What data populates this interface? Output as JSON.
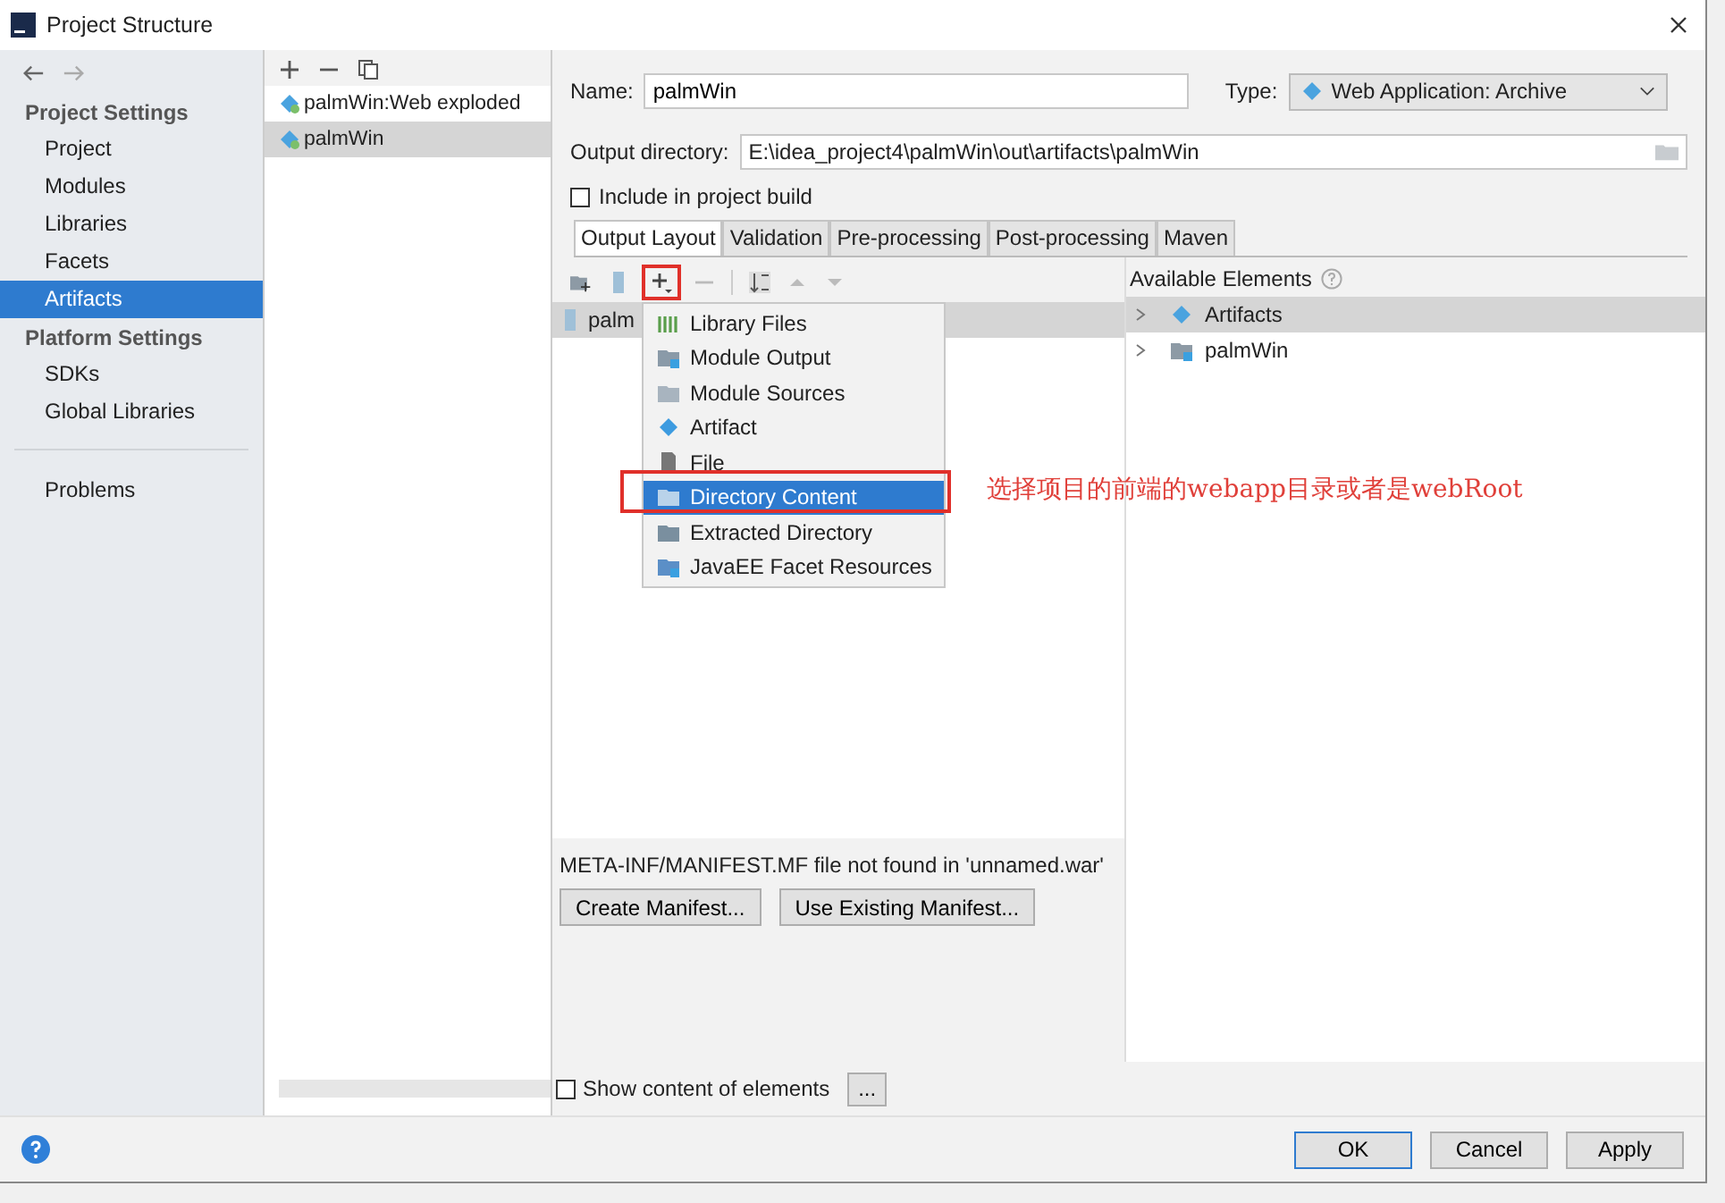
{
  "window": {
    "title": "Project Structure"
  },
  "sidebar": {
    "groups": [
      {
        "title": "Project Settings",
        "items": [
          {
            "label": "Project",
            "selected": false
          },
          {
            "label": "Modules",
            "selected": false
          },
          {
            "label": "Libraries",
            "selected": false
          },
          {
            "label": "Facets",
            "selected": false
          },
          {
            "label": "Artifacts",
            "selected": true
          }
        ]
      },
      {
        "title": "Platform Settings",
        "items": [
          {
            "label": "SDKs",
            "selected": false
          },
          {
            "label": "Global Libraries",
            "selected": false
          }
        ]
      }
    ],
    "extra_items": [
      {
        "label": "Problems",
        "selected": false
      }
    ]
  },
  "artifacts": [
    {
      "label": "palmWin:Web exploded",
      "selected": false
    },
    {
      "label": "palmWin",
      "selected": true
    }
  ],
  "name_field": {
    "label": "Name:",
    "value": "palmWin"
  },
  "type_field": {
    "label": "Type:",
    "value": "Web Application: Archive"
  },
  "output_directory": {
    "label": "Output directory:",
    "value": "E:\\idea_project4\\palmWin\\out\\artifacts\\palmWin"
  },
  "include_in_build": {
    "label": "Include in project build",
    "checked": false
  },
  "tabs": [
    {
      "label": "Output Layout",
      "selected": true
    },
    {
      "label": "Validation",
      "selected": false
    },
    {
      "label": "Pre-processing",
      "selected": false
    },
    {
      "label": "Post-processing",
      "selected": false
    },
    {
      "label": "Maven",
      "selected": false
    }
  ],
  "layout_tree": [
    {
      "label": "palm"
    }
  ],
  "add_menu": [
    {
      "label": "Library Files",
      "kind": "library",
      "selected": false
    },
    {
      "label": "Module Output",
      "kind": "module",
      "selected": false
    },
    {
      "label": "Module Sources",
      "kind": "folder",
      "selected": false
    },
    {
      "label": "Artifact",
      "kind": "artifact",
      "selected": false
    },
    {
      "label": "File",
      "kind": "file",
      "selected": false
    },
    {
      "label": "Directory Content",
      "kind": "folder",
      "selected": true
    },
    {
      "label": "Extracted Directory",
      "kind": "extract",
      "selected": false
    },
    {
      "label": "JavaEE Facet Resources",
      "kind": "facet",
      "selected": false
    }
  ],
  "annotation": "选择项目的前端的webapp目录或者是webRoot",
  "available_elements": {
    "title": "Available Elements",
    "items": [
      {
        "label": "Artifacts",
        "kind": "artifact",
        "expanded": false,
        "selected": true
      },
      {
        "label": "palmWin",
        "kind": "module",
        "expanded": false,
        "selected": false
      }
    ]
  },
  "manifest": {
    "message": "META-INF/MANIFEST.MF file not found in 'unnamed.war'",
    "buttons": [
      "Create Manifest...",
      "Use Existing Manifest..."
    ]
  },
  "show_content": {
    "label": "Show content of elements",
    "checked": false,
    "button": "..."
  },
  "footer_buttons": [
    {
      "label": "OK",
      "default": true
    },
    {
      "label": "Cancel",
      "default": false
    },
    {
      "label": "Apply",
      "default": false
    }
  ]
}
